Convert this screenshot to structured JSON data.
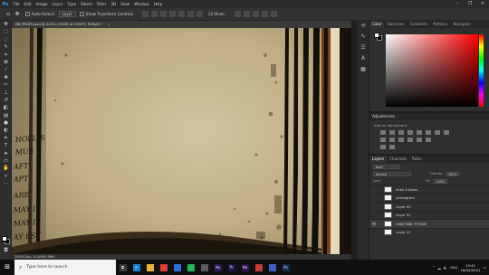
{
  "menu": [
    "File",
    "Edit",
    "Image",
    "Layer",
    "Type",
    "Select",
    "Filter",
    "3D",
    "View",
    "Window",
    "Help"
  ],
  "app_logo": "Ps",
  "options_bar": {
    "auto_select_label": "Auto-Select:",
    "auto_select_value": "Layer",
    "show_transform_label": "Show Transform Controls",
    "mode_3d_label": "3D Mode:"
  },
  "document": {
    "tab_title": "BB_PROPS.psd @ 200% (OOZE ACCENTS, RGB/8) *",
    "status": "200%    Doc: 5.14M/5.98M"
  },
  "color_panel": {
    "tabs": [
      "Color",
      "Swatches",
      "Gradients",
      "Patterns",
      "Navigator"
    ],
    "active_tab": "Color"
  },
  "adjustments": {
    "title": "Adjustments",
    "subtitle": "Add an adjustment"
  },
  "layers_panel": {
    "tabs": [
      "Layers",
      "Channels",
      "Paths"
    ],
    "active_tab": "Layers",
    "kind_label": "Kind",
    "blend_mode": "Normal",
    "opacity_label": "Opacity:",
    "opacity_value": "100%",
    "lock_label": "Lock:",
    "fill_label": "Fill:",
    "fill_value": "100%",
    "layers": [
      {
        "name": "ehes 4 times",
        "visible": false
      },
      {
        "name": "pentagram",
        "visible": false
      },
      {
        "name": "Layer 55",
        "visible": false
      },
      {
        "name": "Layer 52",
        "visible": false
      },
      {
        "name": "ONLY BBK Y'OUNE",
        "visible": true
      },
      {
        "name": "Layer 12",
        "visible": false
      }
    ]
  },
  "taskbar": {
    "search_placeholder": "Type here to search",
    "apps": [
      {
        "name": "task-view",
        "color": "#3a3a3a",
        "glyph": "⧉"
      },
      {
        "name": "edge",
        "color": "#1a7fd4",
        "glyph": "e"
      },
      {
        "name": "file-explorer",
        "color": "#e8b33c",
        "glyph": ""
      },
      {
        "name": "chrome",
        "color": "#d9413a",
        "glyph": ""
      },
      {
        "name": "mail",
        "color": "#2b6fd6",
        "glyph": ""
      },
      {
        "name": "spotify",
        "color": "#1db954",
        "glyph": ""
      },
      {
        "name": "store",
        "color": "#5b5b5b",
        "glyph": ""
      },
      {
        "name": "after-effects",
        "color": "#2a1650",
        "glyph": "Ae"
      },
      {
        "name": "premiere",
        "color": "#1f1449",
        "glyph": "Pr"
      },
      {
        "name": "after-effects-2",
        "color": "#2a1650",
        "glyph": "Ae"
      },
      {
        "name": "app-red",
        "color": "#c23a3a",
        "glyph": ""
      },
      {
        "name": "app-blue",
        "color": "#3a5fc2",
        "glyph": ""
      },
      {
        "name": "photoshop",
        "color": "#0f2a4a",
        "glyph": "Ps"
      }
    ],
    "language": "ENG",
    "time": "13:41",
    "date": "16/02/2021"
  },
  "canvas_text": "HOLLIS\nMUS\nAFT\nAPT\nARE\nMAY IX\nMAY IX\nAY EST"
}
